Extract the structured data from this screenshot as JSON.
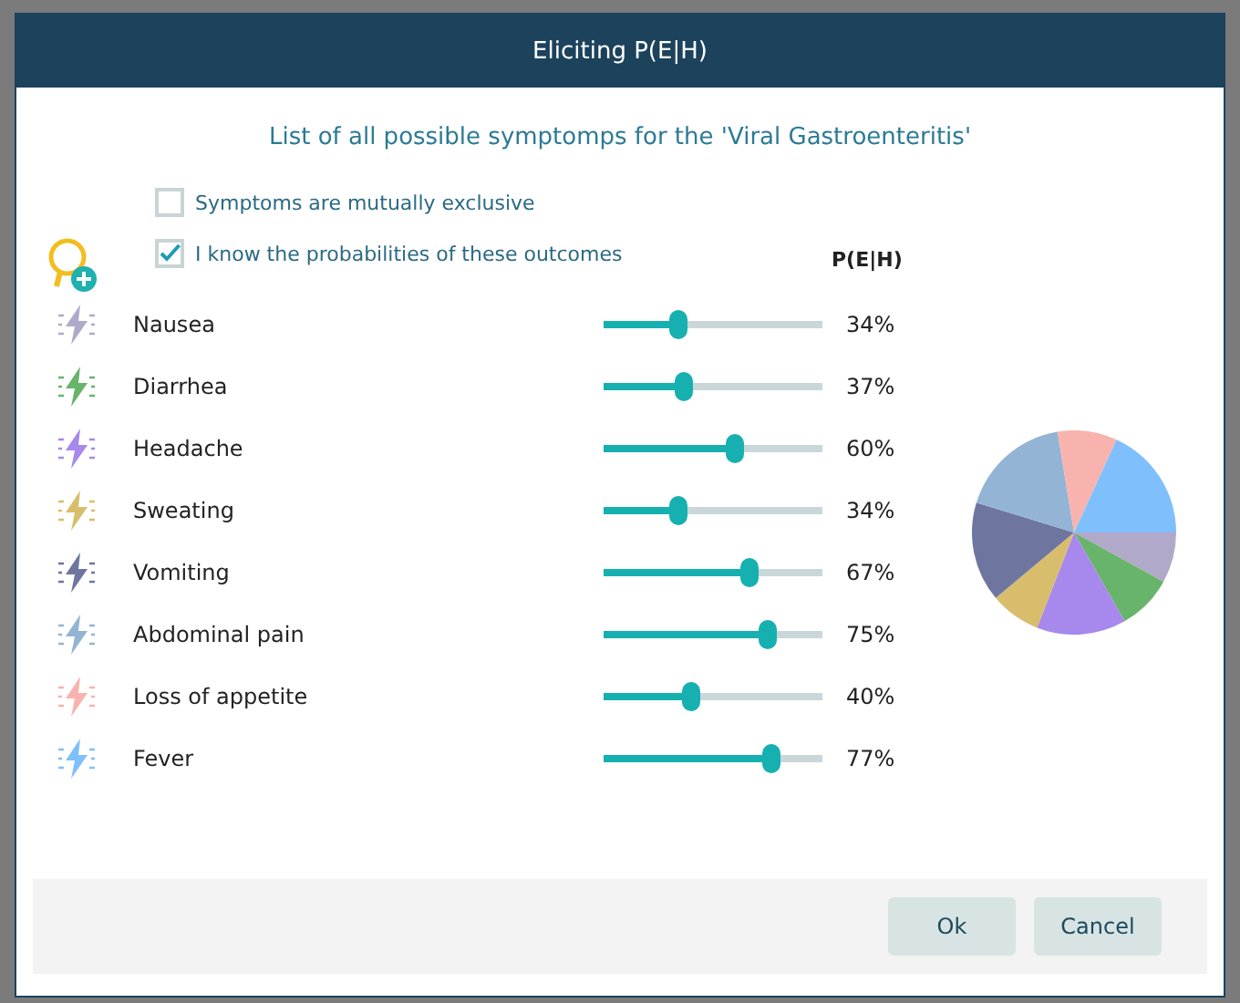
{
  "window": {
    "title": "Eliciting P(E|H)"
  },
  "heading": "List of all possible symptomps for the 'Viral Gastroenteritis'",
  "options": [
    {
      "label": "Symptoms are mutually exclusive",
      "checked": false
    },
    {
      "label": "I know the probabilities of these outcomes",
      "checked": true
    }
  ],
  "column_header": "P(E|H)",
  "symptoms": [
    {
      "name": "Nausea",
      "level": 0.34,
      "reading": "34%",
      "color": "#b1a9c9"
    },
    {
      "name": "Diarrhea",
      "level": 0.37,
      "reading": "37%",
      "color": "#68b46a"
    },
    {
      "name": "Headache",
      "level": 0.6,
      "reading": "60%",
      "color": "#a788ec"
    },
    {
      "name": "Sweating",
      "level": 0.34,
      "reading": "34%",
      "color": "#d8bd6c"
    },
    {
      "name": "Vomiting",
      "level": 0.67,
      "reading": "67%",
      "color": "#6e76a0"
    },
    {
      "name": "Abdominal pain",
      "level": 0.75,
      "reading": "75%",
      "color": "#93b4d4"
    },
    {
      "name": "Loss of appetite",
      "level": 0.4,
      "reading": "40%",
      "color": "#f8b3ae"
    },
    {
      "name": "Fever",
      "level": 0.77,
      "reading": "77%",
      "color": "#7fbffc"
    }
  ],
  "buttons": [
    "Ok",
    "Cancel"
  ]
}
